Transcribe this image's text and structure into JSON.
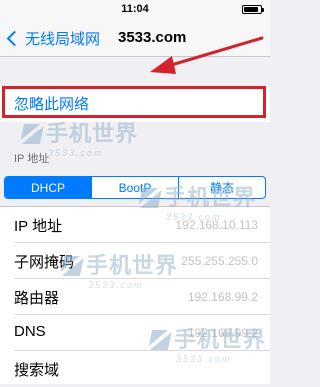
{
  "status_bar": {
    "time": "11:04"
  },
  "nav": {
    "back_label": "无线局域网",
    "title": "3533.com"
  },
  "forget": {
    "label": "忽略此网络"
  },
  "section": {
    "header": "IP 地址"
  },
  "segments": [
    {
      "label": "DHCP",
      "selected": true
    },
    {
      "label": "BootP",
      "selected": false
    },
    {
      "label": "静态",
      "selected": false
    }
  ],
  "rows": [
    {
      "key": "IP 地址",
      "value": "192.168.10.113"
    },
    {
      "key": "子网掩码",
      "value": "255.255.255.0"
    },
    {
      "key": "路由器",
      "value": "192.168.99.2"
    },
    {
      "key": "DNS",
      "value": "192.168.99.2"
    },
    {
      "key": "搜索域",
      "value": ""
    }
  ],
  "watermark": {
    "main": "手机世界",
    "sub": "3533.com"
  },
  "colors": {
    "accent": "#007aff",
    "highlight": "#d3222a",
    "background": "#efeff4"
  }
}
